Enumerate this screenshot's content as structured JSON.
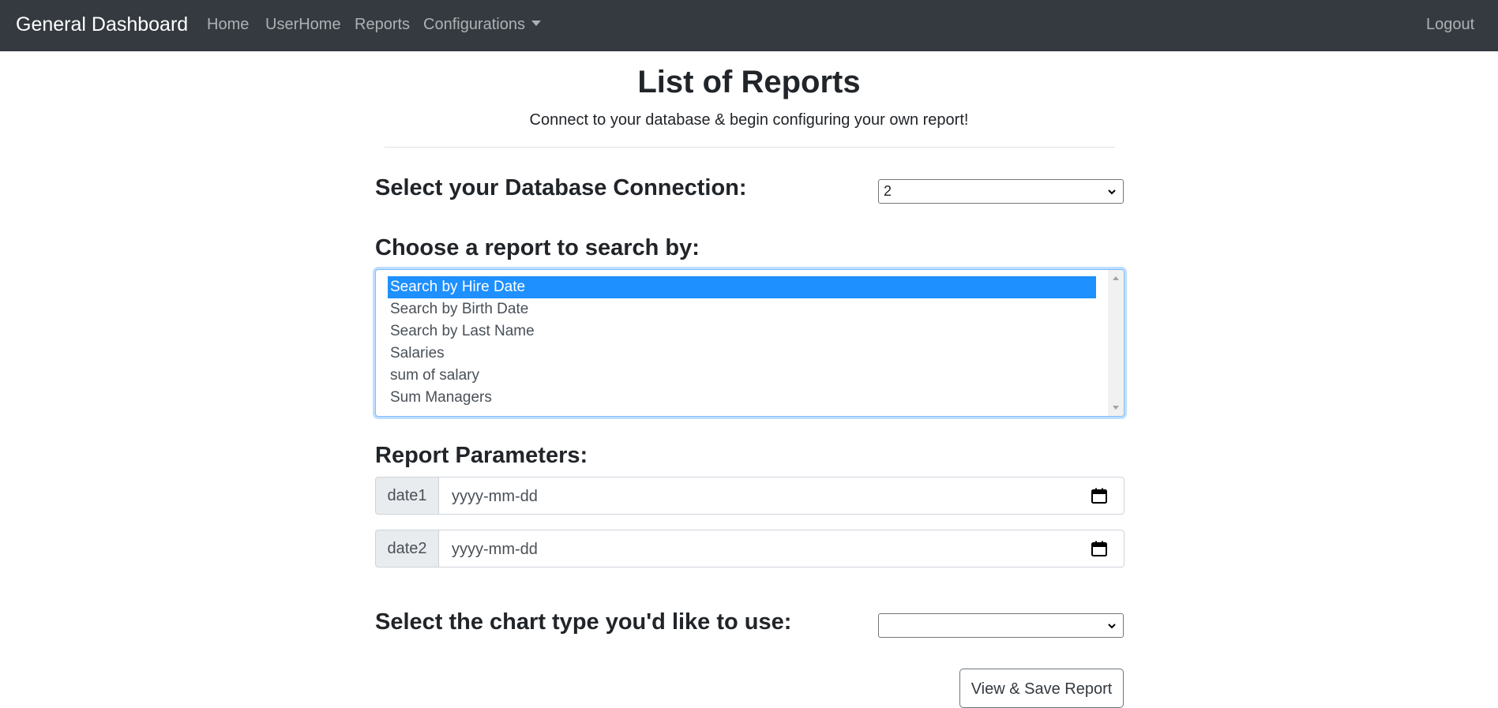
{
  "navbar": {
    "brand": "General Dashboard",
    "links": [
      "Home",
      "UserHome",
      "Reports",
      "Configurations"
    ],
    "logout": "Logout"
  },
  "page": {
    "title": "List of Reports",
    "lead": "Connect to your database & begin configuring your own report!"
  },
  "db_connection": {
    "label": "Select your Database Connection:",
    "selected": "2"
  },
  "report_list": {
    "label": "Choose a report to search by:",
    "options": [
      "Search by Hire Date",
      "Search by Birth Date",
      "Search by Last Name",
      "Salaries",
      "sum of salary",
      "Sum Managers"
    ],
    "selected_index": 0
  },
  "parameters": {
    "label": "Report Parameters:",
    "fields": [
      {
        "name": "date1",
        "placeholder": "yyyy-mm-dd"
      },
      {
        "name": "date2",
        "placeholder": "yyyy-mm-dd"
      }
    ]
  },
  "chart_type": {
    "label": "Select the chart type you'd like to use:",
    "selected": ""
  },
  "actions": {
    "view_save": "View & Save Report"
  },
  "icons": {
    "dropdown": "chevron-down-icon",
    "calendar": "calendar-icon",
    "nav_caret": "caret-down-icon"
  },
  "colors": {
    "navbar": "#343a40",
    "selected_option": "#1e90ff",
    "focus_border": "#80bdff"
  }
}
